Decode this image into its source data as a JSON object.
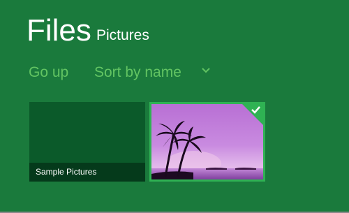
{
  "header": {
    "title": "Files",
    "location": "Pictures"
  },
  "commands": {
    "go_up": "Go up",
    "sort": "Sort by name",
    "sort_icon": "chevron-down-icon"
  },
  "tiles": [
    {
      "label": "Sample Pictures",
      "type": "folder"
    },
    {
      "type": "image",
      "selected": true,
      "selection_icon": "checkmark-icon"
    }
  ],
  "colors": {
    "background": "#1a7a3c",
    "accent": "#62c462",
    "folder_tile": "#0b5a2a",
    "selection": "#2fb253"
  }
}
